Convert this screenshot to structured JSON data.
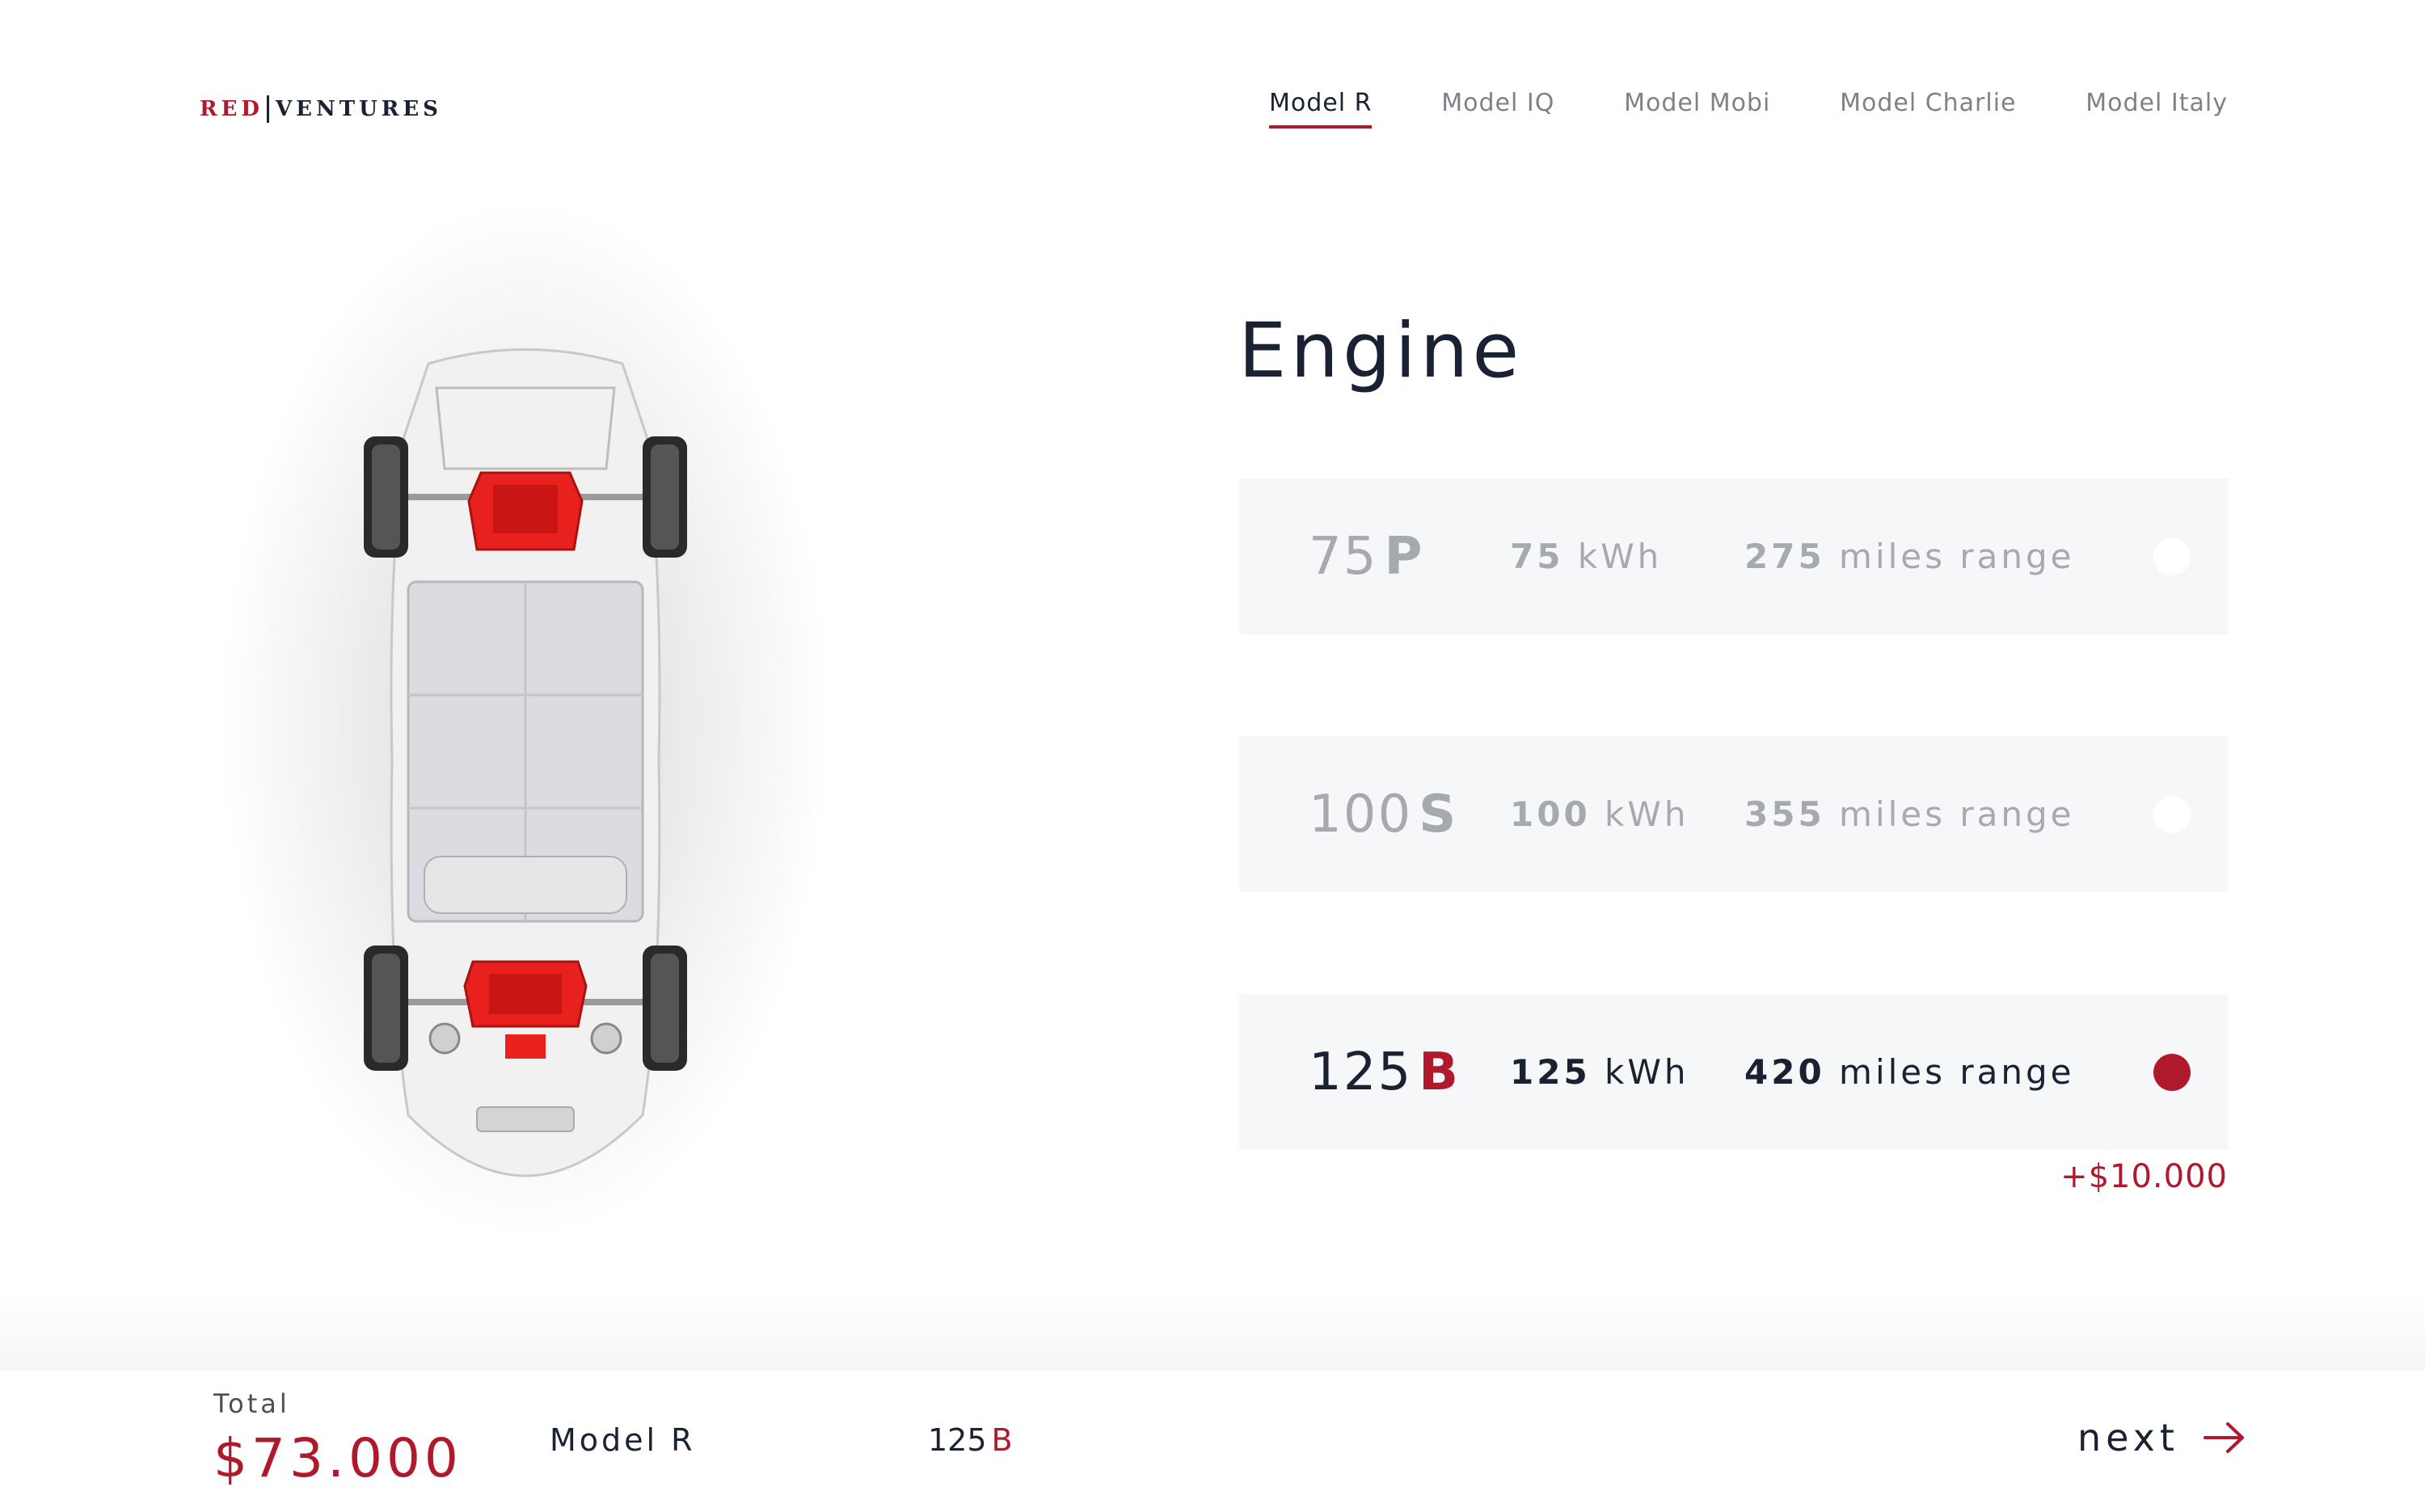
{
  "brand": {
    "part1": "RED",
    "part2": "VENTURES"
  },
  "nav": [
    {
      "label": "Model R",
      "active": true
    },
    {
      "label": "Model IQ",
      "active": false
    },
    {
      "label": "Model Mobi",
      "active": false
    },
    {
      "label": "Model Charlie",
      "active": false
    },
    {
      "label": "Model Italy",
      "active": false
    }
  ],
  "section": {
    "title": "Engine"
  },
  "options": [
    {
      "num": "75",
      "letter": "P",
      "kwh_value": "75",
      "kwh_unit": "kWh",
      "range_value": "275",
      "range_unit": "miles range",
      "selected": false
    },
    {
      "num": "100",
      "letter": "S",
      "kwh_value": "100",
      "kwh_unit": "kWh",
      "range_value": "355",
      "range_unit": "miles range",
      "selected": false
    },
    {
      "num": "125",
      "letter": "B",
      "kwh_value": "125",
      "kwh_unit": "kWh",
      "range_value": "420",
      "range_unit": "miles range",
      "selected": true
    }
  ],
  "price_addon": "+$10.000",
  "footer": {
    "total_label": "Total",
    "total_value": "$73.000",
    "model": "Model R",
    "engine_num": "125",
    "engine_letter": "B",
    "next_label": "next"
  },
  "colors": {
    "accent": "#b0192b",
    "text": "#1a2132",
    "muted": "#a6aab0",
    "option_bg": "#f6f7f9"
  },
  "icons": {
    "next": "arrow-right-icon",
    "car": "car-chassis-illustration"
  }
}
